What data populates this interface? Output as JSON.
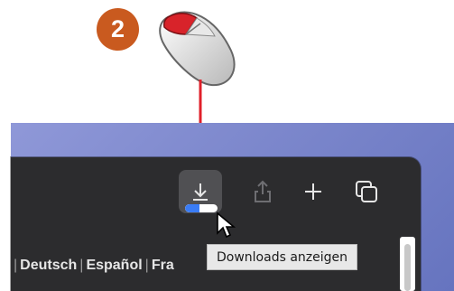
{
  "annotation": {
    "step_number": "2"
  },
  "toolbar": {
    "downloads_icon": "download-arrow-icon",
    "share_icon": "share-icon",
    "new_tab_icon": "plus-icon",
    "tabs_overview_icon": "tabs-overview-icon",
    "download_progress": 0.45
  },
  "tooltip": {
    "text": "Downloads anzeigen"
  },
  "languages": [
    "Deutsch",
    "Español",
    "Fra"
  ],
  "separator": "|",
  "colors": {
    "badge": "#c95a1f",
    "arrow": "#e0202a",
    "progress": "#3a7cf5",
    "window": "#2c2c2e"
  }
}
